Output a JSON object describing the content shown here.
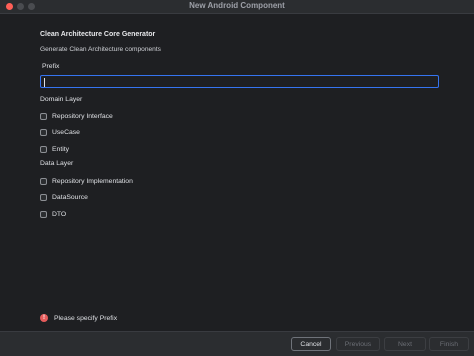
{
  "window": {
    "title": "New Android Component"
  },
  "header": {
    "title": "Clean Architecture Core Generator",
    "subtitle": "Generate Clean Architecture components"
  },
  "prefix": {
    "label": "Prefix",
    "value": "",
    "placeholder": ""
  },
  "domain_layer": {
    "label": "Domain Layer",
    "items": [
      {
        "label": "Repository Interface",
        "checked": false
      },
      {
        "label": "UseCase",
        "checked": false
      },
      {
        "label": "Entity",
        "checked": false
      }
    ]
  },
  "data_layer": {
    "label": "Data Layer",
    "items": [
      {
        "label": "Repository Implementation",
        "checked": false
      },
      {
        "label": "DataSource",
        "checked": false
      },
      {
        "label": "DTO",
        "checked": false
      }
    ]
  },
  "validation": {
    "icon": "error-icon",
    "message": "Please specify Prefix",
    "color": "#e55b5b"
  },
  "footer": {
    "cancel_label": "Cancel",
    "previous_label": "Previous",
    "next_label": "Next",
    "finish_label": "Finish"
  },
  "colors": {
    "accent": "#3574f0",
    "background": "#1e1f22"
  }
}
